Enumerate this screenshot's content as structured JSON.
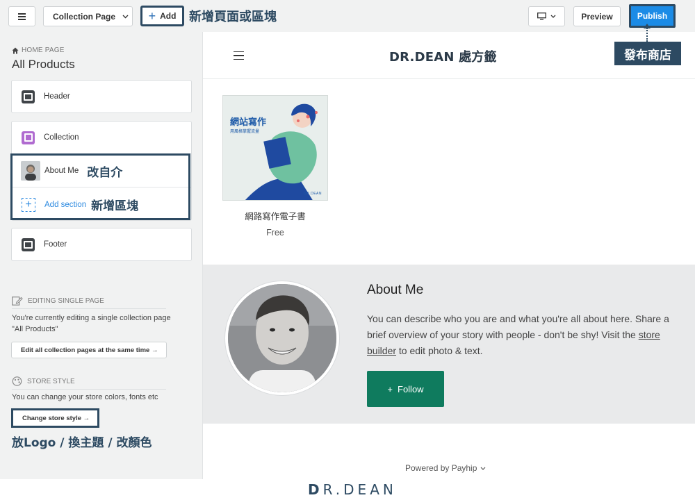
{
  "toolbar": {
    "page_select_label": "Collection Page",
    "add_label": "Add",
    "preview_label": "Preview",
    "publish_label": "Publish"
  },
  "annotations": {
    "add": "新增頁面或區塊",
    "publish": "發布商店",
    "about_me": "改自介",
    "add_section": "新增區塊",
    "store_style": "放Logo /  換主題 / 改顏色"
  },
  "sidebar": {
    "breadcrumb": "HOME PAGE",
    "title": "All Products",
    "sections": {
      "header": "Header",
      "collection": "Collection",
      "about_me": "About Me",
      "add_section": "Add section",
      "footer": "Footer"
    },
    "editing_single": {
      "heading": "EDITING SINGLE PAGE",
      "text_line1": "You're currently editing a single collection page",
      "text_line2": "\"All Products\"",
      "button": "Edit all collection pages at the same time →"
    },
    "store_style": {
      "heading": "STORE STYLE",
      "text": "You can change your store colors, fonts etc",
      "button": "Change store style →"
    }
  },
  "preview": {
    "store_name": "DR.DEAN 處方籤",
    "product": {
      "cover_title": "網站寫作",
      "cover_subtitle": "用風格掌握流量",
      "cover_brand": "DR.DEAN",
      "name": "網路寫作電子書",
      "price": "Free"
    },
    "about": {
      "title": "About Me",
      "text_before": "You can describe who you are and what you're all about here. Share a brief overview of your story with people - don't be shy! Visit the ",
      "link": "store builder",
      "text_after": " to edit photo & text.",
      "follow_label": "Follow"
    },
    "powered_by": "Powered by Payhip"
  },
  "footer_logo": {
    "part1": "R.DEAN",
    "mark": "D"
  },
  "colors": {
    "publish_blue": "#1b8be6",
    "annotation_navy": "#2d4a62",
    "follow_green": "#0f7b5e",
    "link_blue": "#2d8ae0"
  }
}
